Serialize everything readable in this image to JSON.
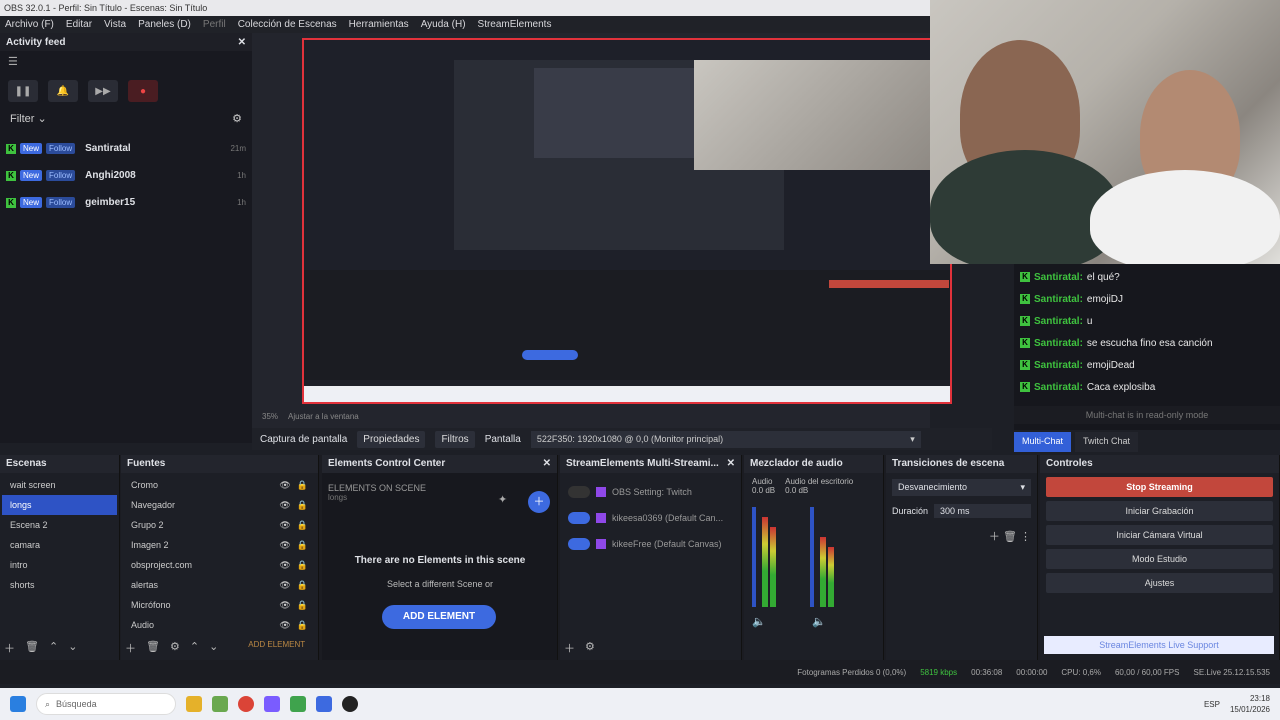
{
  "window": {
    "title": "OBS 32.0.1 - Perfil: Sin Título - Escenas: Sin Título"
  },
  "menu": [
    "Archivo (F)",
    "Editar",
    "Vista",
    "Paneles (D)",
    "Perfil",
    "Colección de Escenas",
    "Herramientas",
    "Ayuda (H)",
    "StreamElements"
  ],
  "feed": {
    "title": "Activity feed",
    "filter_label": "Filter",
    "rows": [
      {
        "tag": "New",
        "type": "Follow",
        "name": "Santiratal",
        "time": "21m"
      },
      {
        "tag": "New",
        "type": "Follow",
        "name": "Anghi2008",
        "time": "1h"
      },
      {
        "tag": "New",
        "type": "Follow",
        "name": "geimber15",
        "time": "1h"
      }
    ]
  },
  "chat": {
    "messages": [
      {
        "user": "Santiratal:",
        "text": "el qué?"
      },
      {
        "user": "Santiratal:",
        "text": "emojiDJ"
      },
      {
        "user": "Santiratal:",
        "text": "u"
      },
      {
        "user": "Santiratal:",
        "text": "se escucha fino esa canción"
      },
      {
        "user": "Santiratal:",
        "text": "emojiDead"
      },
      {
        "user": "Santiratal:",
        "text": "Caca explosiba"
      }
    ],
    "readonly_note": "Multi-chat is in read-only mode",
    "tabs": [
      "Multi-Chat",
      "Twitch Chat"
    ]
  },
  "zoom": {
    "value": "35%",
    "fit_label": "Ajustar a la ventana"
  },
  "source_bar": {
    "source_name": "Captura de pantalla",
    "properties": "Propiedades",
    "filters": "Filtros",
    "screen_label": "Pantalla",
    "screen_value": "522F350: 1920x1080 @ 0,0 (Monitor principal)"
  },
  "scenes": {
    "title": "Escenas",
    "items": [
      "wait screen",
      "longs",
      "Escena 2",
      "camara",
      "intro",
      "shorts"
    ],
    "selected": 1
  },
  "sources": {
    "title": "Fuentes",
    "items": [
      "Cromo",
      "Navegador",
      "Grupo 2",
      "Imagen 2",
      "obsproject.com",
      "alertas",
      "Micrófono",
      "Audio"
    ],
    "add_element": "ADD ELEMENT"
  },
  "ecc": {
    "title": "Elements Control Center",
    "heading": "ELEMENTS ON SCENE",
    "scene": "longs",
    "empty_title": "There are no Elements in this scene",
    "empty_sub": "Select a different Scene or",
    "add_button": "ADD ELEMENT"
  },
  "multistream": {
    "title": "StreamElements Multi-Streami...",
    "rows": [
      "OBS Setting: Twitch",
      "kikeesa0369 (Default Can...",
      "kikeeFree (Default Canvas)"
    ]
  },
  "mixer": {
    "title": "Mezclador de audio",
    "channels": [
      {
        "name": "Audio",
        "db": "0.0 dB"
      },
      {
        "name": "Audio del escritorio",
        "db": "0.0 dB"
      }
    ]
  },
  "transitions": {
    "title": "Transiciones de escena",
    "value": "Desvanecimiento",
    "duration_label": "Duración",
    "duration_value": "300 ms"
  },
  "controls": {
    "title": "Controles",
    "buttons": [
      "Stop Streaming",
      "Iniciar Grabación",
      "Iniciar Cámara Virtual",
      "Modo Estudio",
      "Ajustes"
    ],
    "support": "StreamElements Live Support"
  },
  "status": {
    "dropped": "Fotogramas Perdidos 0 (0,0%)",
    "kbps": "5819 kbps",
    "live_time": "00:36:08",
    "rec_time": "00:00:00",
    "cpu": "CPU: 0,6%",
    "fps": "60,00 / 60,00 FPS",
    "version": "SE.Live 25.12.15.535"
  },
  "taskbar": {
    "search_placeholder": "Búsqueda",
    "lang": "ESP",
    "time": "23:18",
    "date": "15/01/2026"
  },
  "colors": {
    "accent": "#3d6ae0",
    "live_red": "#c2473c",
    "chat_green": "#3fc23f"
  }
}
